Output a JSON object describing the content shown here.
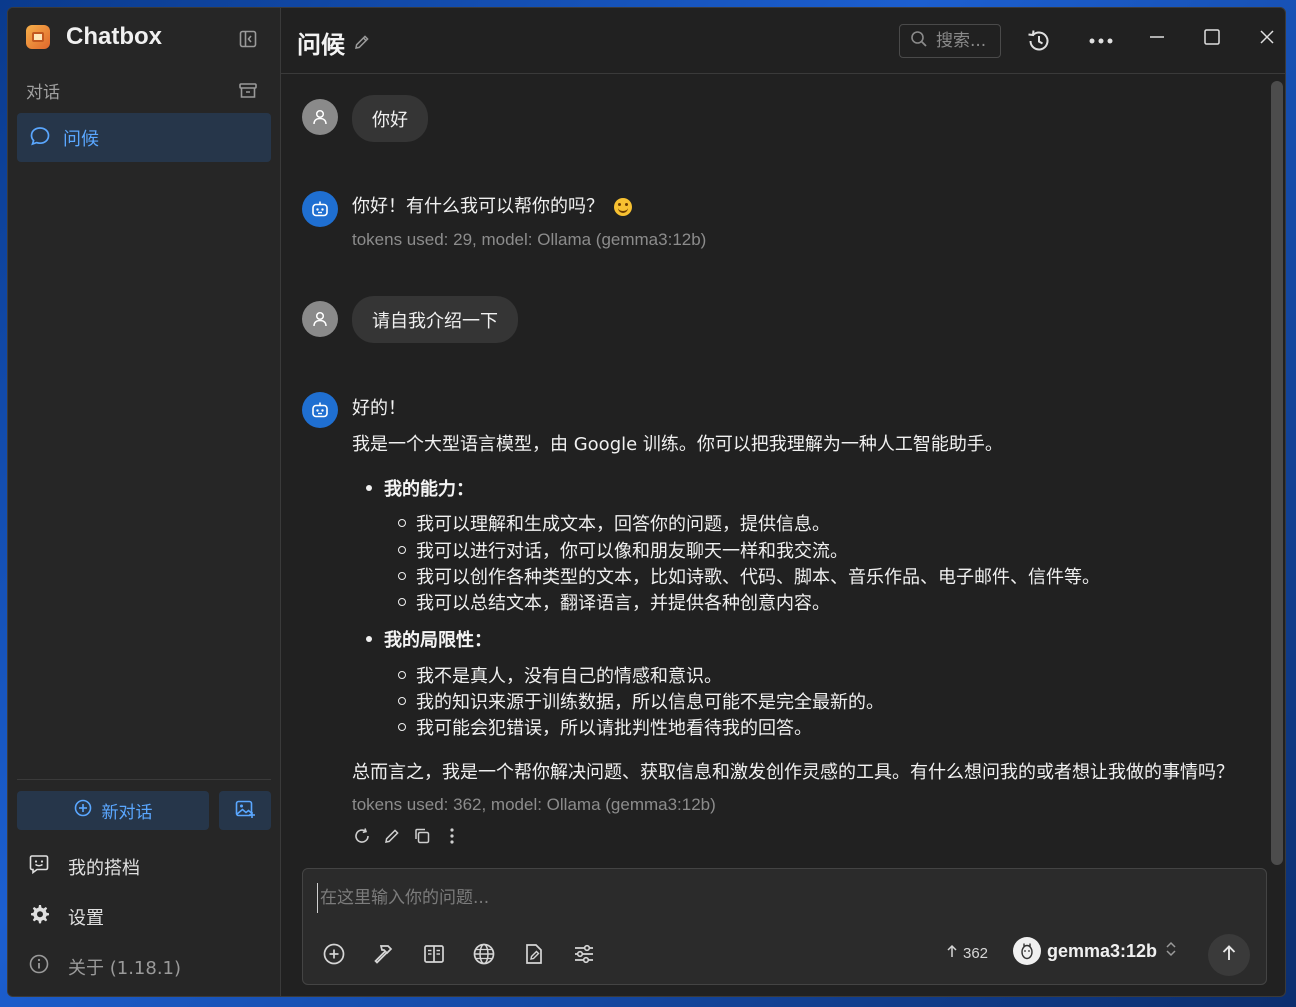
{
  "app": {
    "name": "Chatbox"
  },
  "sidebar": {
    "section_title": "对话",
    "conversations": [
      {
        "label": "问候",
        "active": true
      }
    ],
    "new_chat_label": "新对话",
    "links": [
      {
        "label": "我的搭档",
        "icon": "partner-icon"
      },
      {
        "label": "设置",
        "icon": "gear-icon"
      },
      {
        "label": "关于 (1.18.1)",
        "icon": "info-icon"
      }
    ]
  },
  "header": {
    "title": "问候",
    "search_placeholder": "搜索..."
  },
  "messages": [
    {
      "role": "user",
      "text": "你好"
    },
    {
      "role": "assistant",
      "text": "你好！有什么我可以帮你的吗？",
      "meta": "tokens used: 29, model: Ollama (gemma3:12b)"
    },
    {
      "role": "user",
      "text": "请自我介绍一下"
    },
    {
      "role": "assistant",
      "intro": "好的！",
      "line1": "我是一个大型语言模型，由 Google 训练。你可以把我理解为一种人工智能助手。",
      "sections": [
        {
          "heading": "我的能力：",
          "items": [
            "我可以理解和生成文本，回答你的问题，提供信息。",
            "我可以进行对话，你可以像和朋友聊天一样和我交流。",
            "我可以创作各种类型的文本，比如诗歌、代码、脚本、音乐作品、电子邮件、信件等。",
            "我可以总结文本，翻译语言，并提供各种创意内容。"
          ]
        },
        {
          "heading": "我的局限性：",
          "items": [
            "我不是真人，没有自己的情感和意识。",
            "我的知识来源于训练数据，所以信息可能不是完全最新的。",
            "我可能会犯错误，所以请批判性地看待我的回答。"
          ]
        }
      ],
      "conclusion": "总而言之，我是一个帮你解决问题、获取信息和激发创作灵感的工具。有什么想问我的或者想让我做的事情吗？",
      "meta": "tokens used: 362, model: Ollama (gemma3:12b)"
    }
  ],
  "composer": {
    "placeholder": "在这里输入你的问题...",
    "token_count": "362",
    "model": "gemma3:12b"
  },
  "colors": {
    "accent": "#5aa7ff",
    "bot_avatar": "#1f6fd1"
  }
}
